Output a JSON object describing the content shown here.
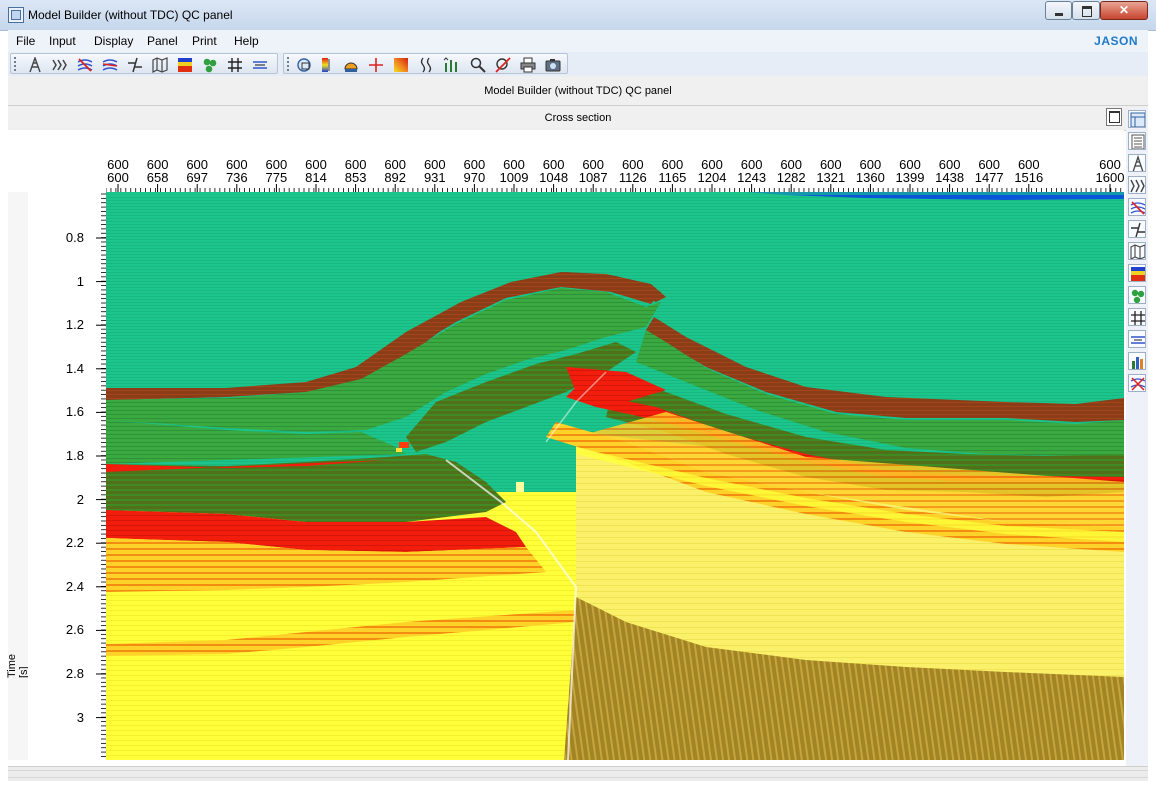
{
  "window": {
    "title": "Model Builder (without TDC) QC panel"
  },
  "menu": {
    "items": [
      "File",
      "Input",
      "Display",
      "Panel",
      "Print",
      "Help"
    ],
    "brand": "JASON"
  },
  "toolbar": {
    "group1": [
      "fault-icon",
      "horizons-icon",
      "delete-horizon-icon",
      "horizon-edit-icon",
      "fault-edit-icon",
      "map-icon",
      "color-bar-icon",
      "wells-icon",
      "grid-icon",
      "flatten-icon"
    ],
    "group2": [
      "zoom-fit-icon",
      "color-scale-icon",
      "display-settings-icon",
      "crosshair-icon",
      "color-palette-icon",
      "trace-icon",
      "chart-icon",
      "zoom-icon",
      "no-zoom-icon",
      "print-icon",
      "camera-icon"
    ]
  },
  "panel": {
    "title": "Model Builder (without TDC) QC panel"
  },
  "cross_section": {
    "title": "Cross section"
  },
  "axes": {
    "x_top_row": [
      "600",
      "600",
      "600",
      "600",
      "600",
      "600",
      "600",
      "600",
      "600",
      "600",
      "600",
      "600",
      "600",
      "600",
      "600",
      "600",
      "600",
      "600",
      "600",
      "600",
      "600",
      "600",
      "600",
      "600"
    ],
    "x_bottom_row": [
      "600",
      "658",
      "697",
      "736",
      "775",
      "814",
      "853",
      "892",
      "931",
      "970",
      "1009",
      "1048",
      "1087",
      "1126",
      "1165",
      "1204",
      "1243",
      "1282",
      "1321",
      "1360",
      "1399",
      "1438",
      "1477",
      "1516",
      "1600"
    ],
    "y_title": "Time [s]",
    "y_ticks": [
      "0.8",
      "1",
      "1.2",
      "1.4",
      "1.6",
      "1.8",
      "2",
      "2.2",
      "2.4",
      "2.6",
      "2.8",
      "3"
    ]
  },
  "right_sidebar": {
    "icons": [
      "layout-icon",
      "list-icon",
      "fault-icon",
      "horizons-icon",
      "delete-horizon-icon",
      "fault-edit-icon",
      "map-icon",
      "color-bar-icon",
      "wells-icon",
      "grid-icon",
      "flatten-icon",
      "histogram-icon",
      "delete-well-icon"
    ]
  },
  "colors": {
    "window_bg": "#ffffff",
    "brand": "#1f7ac8",
    "seafloor_green": "#1bc58c",
    "shallow_blue": "#0b55d8",
    "brown": "#8a3d17",
    "mid_green": "#37a541",
    "dark_green": "#4e6c1a",
    "red": "#f21d0c",
    "orange": "#f49a12",
    "yellow": "#ffff3a",
    "deep_yellow": "#fbf06a",
    "basement": "#a38424"
  }
}
